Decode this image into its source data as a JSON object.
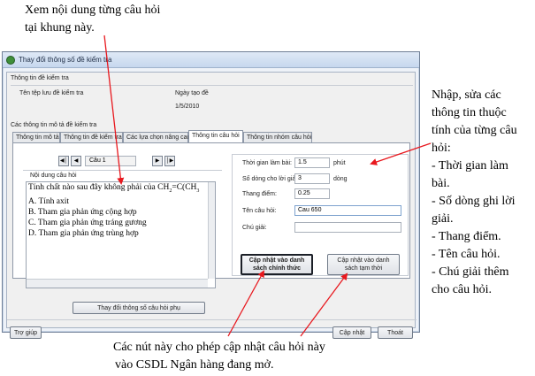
{
  "annotations": {
    "top_line1": "Xem nội dung từng câu hỏi",
    "top_line2": "tại khung này.",
    "right_line1": "Nhập, sửa các",
    "right_line2": "thông tin thuộc",
    "right_line3": "tính của từng câu",
    "right_line4": "hỏi:",
    "right_line5": "- Thời gian làm",
    "right_line6": "bài.",
    "right_line7": "- Số dòng ghi lời",
    "right_line8": "giải.",
    "right_line9": "- Thang điểm.",
    "right_line10": "- Tên câu hỏi.",
    "right_line11": "- Chú giải thêm",
    "right_line12": "cho câu hỏi.",
    "bottom_line1": "Các nút này cho phép cập nhật câu hỏi này",
    "bottom_line2": "vào CSDL Ngân hàng đang mở.",
    "arrow_color": "#e8181e"
  },
  "window": {
    "title": "Thay đổi thông số đề kiểm tra",
    "info_group_label": "Thông tin đề kiểm tra",
    "file_name_label": "Tên tệp lưu đề kiểm tra",
    "date_label": "Ngày tạo đề",
    "date_value": "1/5/2010",
    "desc_group_label": "Các thông tin mô tả đề kiểm tra",
    "tabs": [
      "Thông tin mô tả",
      "Thông tin đề kiểm tra",
      "Các lựa chọn nâng cao",
      "Thông tin câu hỏi",
      "Thông tin nhóm câu hỏi"
    ],
    "active_tab_index": 3,
    "question_nav": {
      "first_icon": "skip-first-icon",
      "prev_icon": "prev-icon",
      "next_icon": "next-icon",
      "last_icon": "skip-last-icon",
      "selected": "Câu 1"
    },
    "content_label": "Nội dung câu hỏi",
    "question_lines": [
      "Tính chất nào sau đây không phải của CH",
      "A. Tính axit",
      "B. Tham gia phản ứng cộng hợp",
      "C. Tham gia phản ứng tráng gương",
      "D. Tham gia phản ứng trùng hợp"
    ],
    "formula_part1": "2",
    "formula_part2": "=C(CH",
    "formula_part3": "3",
    "change_sub_button": "Thay đổi thông số câu hỏi phụ",
    "fields": {
      "time_label": "Thời gian làm bài:",
      "time_value": "1.5",
      "time_unit": "phút",
      "lines_label": "Số dòng cho lời giải:",
      "lines_value": "3",
      "lines_unit": "dòng",
      "score_label": "Thang điểm:",
      "score_value": "0.25",
      "name_label": "Tên câu hỏi:",
      "name_value": "Cau 650",
      "note_label": "Chú giải:",
      "note_value": ""
    },
    "update_official_button_line1": "Cập nhật vào danh",
    "update_official_button_line2": "sách chính thức",
    "update_temp_button_line1": "Cập nhật vào danh",
    "update_temp_button_line2": "sách tạm thời",
    "help_button": "Trợ giúp",
    "update_button": "Cập nhật",
    "exit_button": "Thoát"
  }
}
